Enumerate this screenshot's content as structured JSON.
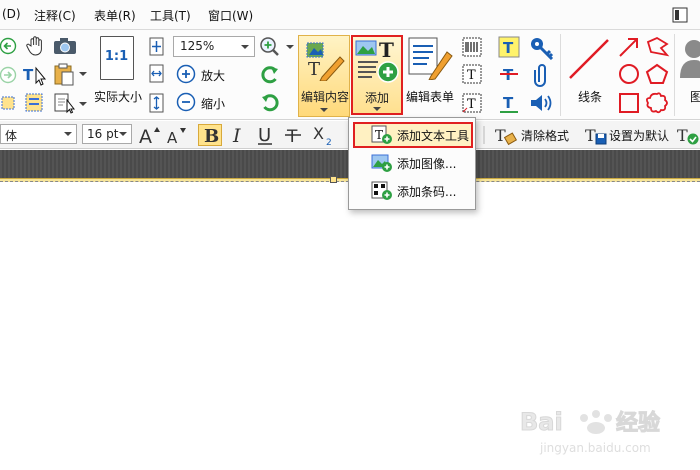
{
  "menubar": {
    "items": [
      "(D)",
      "注释(C)",
      "表单(R)",
      "工具(T)",
      "窗口(W)"
    ]
  },
  "ribbon": {
    "actual_size_label": "实际大小",
    "actual_size_icon_text": "1:1",
    "zoom_value": "125%",
    "zoom_in_label": "放大",
    "zoom_out_label": "缩小",
    "edit_content_label": "编辑内容",
    "add_label": "添加",
    "edit_form_label": "编辑表单",
    "line_label": "线条",
    "truncated_label": "图"
  },
  "formatbar": {
    "font_name": "体",
    "font_size": "16 pt",
    "clear_format_label": "清除格式",
    "set_default_label": "设置为默认"
  },
  "dropdown": {
    "items": [
      "添加文本工具",
      "添加图像...",
      "添加条码..."
    ]
  },
  "watermark": {
    "brand": "Bai",
    "suffix": "经验",
    "url": "jingyan.baidu.com"
  },
  "colors": {
    "highlight": "#e02020",
    "accent_yellow": "#ffe38c",
    "icon_blue": "#1a5fb4",
    "icon_green": "#2ea043",
    "shape_red": "#e01b24"
  }
}
